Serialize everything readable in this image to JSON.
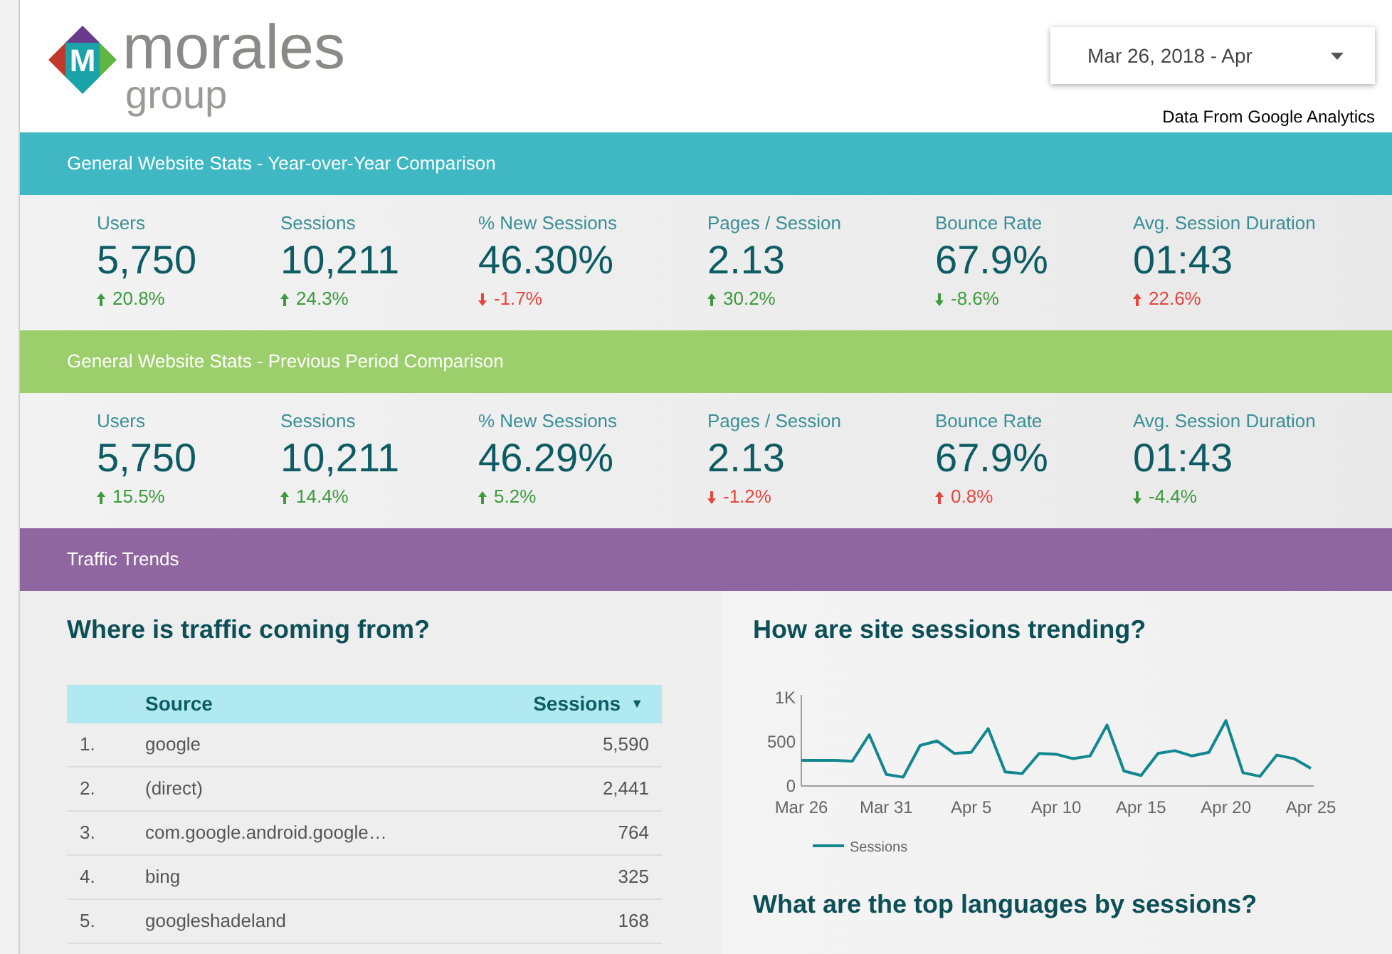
{
  "logo": {
    "mark": "M",
    "name": "morales",
    "subname": "group"
  },
  "date_range": {
    "value": "Mar 26, 2018 - Apr"
  },
  "source_note": "Data From Google Analytics",
  "sections": [
    {
      "title": "General Website Stats - Year-over-Year Comparison",
      "color": "#3fb8c4",
      "metrics": [
        {
          "label": "Users",
          "value": "5,750",
          "delta": "20.8%",
          "kind": "up",
          "color": "#3d9a3d"
        },
        {
          "label": "Sessions",
          "value": "10,211",
          "delta": "24.3%",
          "kind": "up",
          "color": "#3d9a3d"
        },
        {
          "label": "% New Sessions",
          "value": "46.30%",
          "delta": "-1.7%",
          "kind": "down",
          "color": "#e8453c"
        },
        {
          "label": "Pages / Session",
          "value": "2.13",
          "delta": "30.2%",
          "kind": "up",
          "color": "#3d9a3d"
        },
        {
          "label": "Bounce Rate",
          "value": "67.9%",
          "delta": "-8.6%",
          "kind": "down",
          "color": "#3d9a3d"
        },
        {
          "label": "Avg. Session Duration",
          "value": "01:43",
          "delta": "22.6%",
          "kind": "up",
          "color": "#e8453c"
        }
      ]
    },
    {
      "title": "General Website Stats - Previous Period Comparison",
      "color": "#9ccf6b",
      "metrics": [
        {
          "label": "Users",
          "value": "5,750",
          "delta": "15.5%",
          "kind": "up",
          "color": "#3d9a3d"
        },
        {
          "label": "Sessions",
          "value": "10,211",
          "delta": "14.4%",
          "kind": "up",
          "color": "#3d9a3d"
        },
        {
          "label": "% New Sessions",
          "value": "46.29%",
          "delta": "5.2%",
          "kind": "up",
          "color": "#3d9a3d"
        },
        {
          "label": "Pages / Session",
          "value": "2.13",
          "delta": "-1.2%",
          "kind": "down",
          "color": "#e8453c"
        },
        {
          "label": "Bounce Rate",
          "value": "67.9%",
          "delta": "0.8%",
          "kind": "up",
          "color": "#e8453c"
        },
        {
          "label": "Avg. Session Duration",
          "value": "01:43",
          "delta": "-4.4%",
          "kind": "down",
          "color": "#3d9a3d"
        }
      ]
    }
  ],
  "traffic_band": {
    "title": "Traffic Trends",
    "color": "#8f66a0"
  },
  "sources": {
    "title": "Where is traffic coming from?",
    "columns": [
      "Source",
      "Sessions"
    ],
    "sort_icon": "▼",
    "rows": [
      {
        "rank": "1.",
        "source": "google",
        "sessions": "5,590"
      },
      {
        "rank": "2.",
        "source": "(direct)",
        "sessions": "2,441"
      },
      {
        "rank": "3.",
        "source": "com.google.android.google…",
        "sessions": "764"
      },
      {
        "rank": "4.",
        "source": "bing",
        "sessions": "325"
      },
      {
        "rank": "5.",
        "source": "googleshadeland",
        "sessions": "168"
      }
    ]
  },
  "trend": {
    "title": "How are site sessions trending?",
    "chart_data": {
      "type": "line",
      "categories": [
        "Mar 26",
        null,
        null,
        null,
        null,
        "Mar 31",
        null,
        null,
        null,
        null,
        "Apr 5",
        null,
        null,
        null,
        null,
        "Apr 10",
        null,
        null,
        null,
        null,
        "Apr 15",
        null,
        null,
        null,
        null,
        "Apr 20",
        null,
        null,
        null,
        null,
        "Apr 25"
      ],
      "series": [
        {
          "name": "Sessions",
          "color": "#12878f",
          "values": [
            290,
            290,
            290,
            280,
            580,
            130,
            100,
            460,
            510,
            370,
            380,
            650,
            160,
            140,
            370,
            360,
            310,
            340,
            690,
            170,
            120,
            370,
            400,
            340,
            380,
            740,
            150,
            110,
            350,
            310,
            200
          ]
        }
      ],
      "ylim": [
        0,
        1000
      ],
      "yticks": [
        0,
        500,
        {
          "value": 1000,
          "label": "1K"
        }
      ]
    }
  },
  "languages": {
    "title": "What are the top languages by sessions?"
  }
}
